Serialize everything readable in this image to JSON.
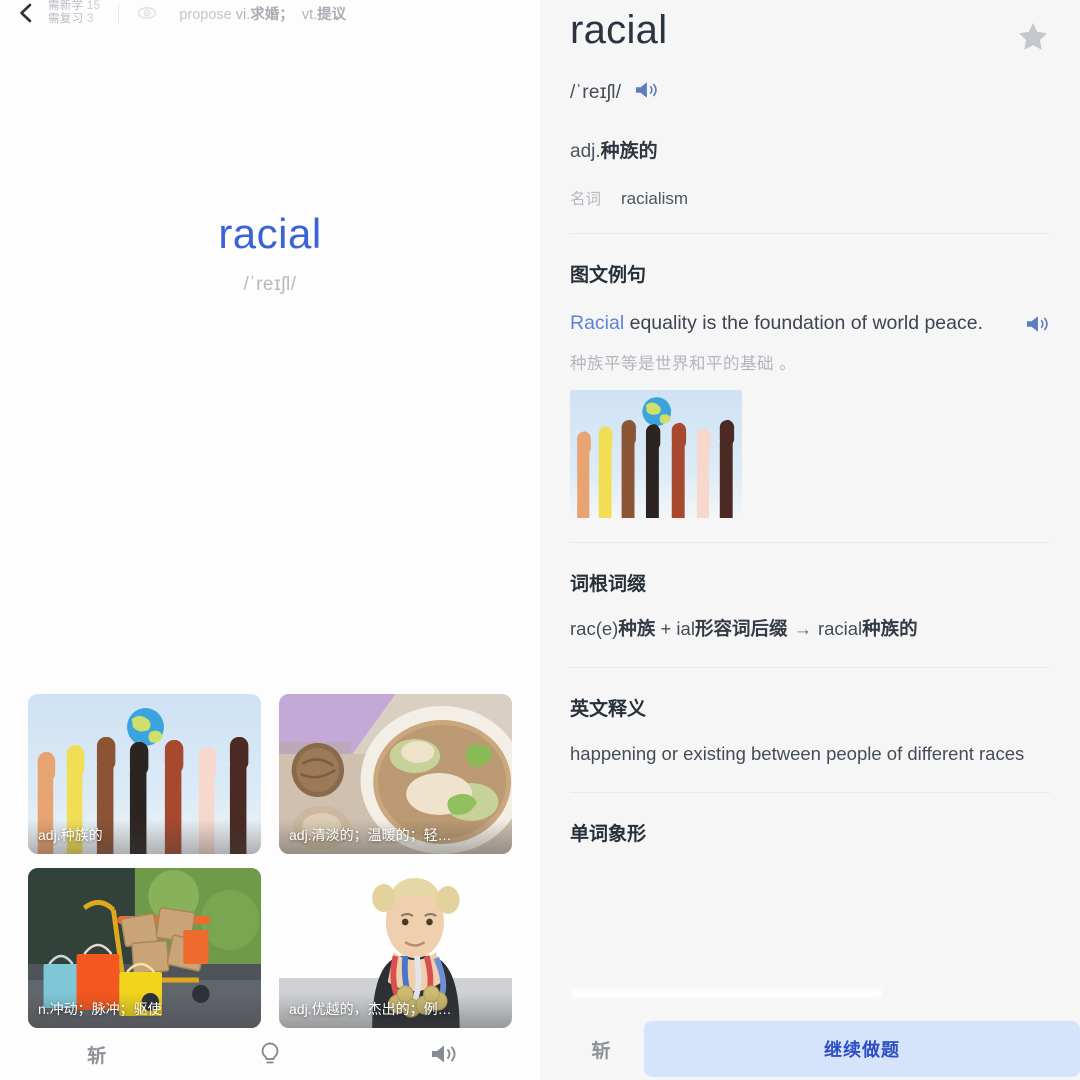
{
  "left": {
    "topbar": {
      "back_icon": "chevron-left-icon",
      "new_words_label": "需新学",
      "new_words_count": "15",
      "review_label": "需复习",
      "review_count": "3",
      "eye_icon": "eye-icon",
      "preview_word": "propose",
      "preview_pos1": "vi.",
      "preview_cn1": "求婚；",
      "preview_pos2": "vt.",
      "preview_cn2": "提议"
    },
    "word": "racial",
    "phonetic": "/ˈreɪʃl/",
    "image_options": [
      {
        "caption": "adj.种族的",
        "art": "hands-globe"
      },
      {
        "caption": "adj.清淡的；温暖的；轻…",
        "art": "soup-bowl"
      },
      {
        "caption": "n.冲动；脉冲；驱使",
        "art": "shopping-cart"
      },
      {
        "caption": "adj.优越的，杰出的；例…",
        "art": "athlete-medals"
      }
    ],
    "toolbar": [
      {
        "name": "zhan-button",
        "label": "斩"
      },
      {
        "name": "hint-bulb-button",
        "label": ""
      },
      {
        "name": "pronounce-button",
        "label": ""
      }
    ]
  },
  "right": {
    "headword": "racial",
    "star_icon": "star-icon",
    "phonetic": "/ˈreɪʃl/",
    "speaker_icon": "speaker-icon",
    "definition_pos": "adj.",
    "definition_cn": "种族的",
    "derived_label": "名词",
    "derived_word": "racialism",
    "sections": {
      "example_title": "图文例句",
      "example_en_highlight": "Racial",
      "example_en_rest": " equality is the foundation of world peace.",
      "example_cn": "种族平等是世界和平的基础 。",
      "example_image_art": "hands-globe",
      "roots_title": "词根词缀",
      "roots_text_a": "rac(e)",
      "roots_text_b": "种族",
      "roots_plus": " + ",
      "roots_text_c": "ial",
      "roots_text_d": "形容词后缀",
      "roots_arrow": "→",
      "roots_text_e": "racial",
      "roots_text_f": "种族的",
      "english_def_title": "英文释义",
      "english_def": "happening or existing between people of different races",
      "pictograph_title": "单词象形"
    },
    "bottom": {
      "zhan_label": "斩",
      "continue_label": "继续做题"
    }
  },
  "colors": {
    "accent_blue": "#3a63d8",
    "button_bg": "#d6e4fb",
    "button_text": "#2f4fc4",
    "left_bg": "#fdfdfd",
    "right_bg": "#f6f6f7",
    "muted": "#b5b8bf"
  }
}
